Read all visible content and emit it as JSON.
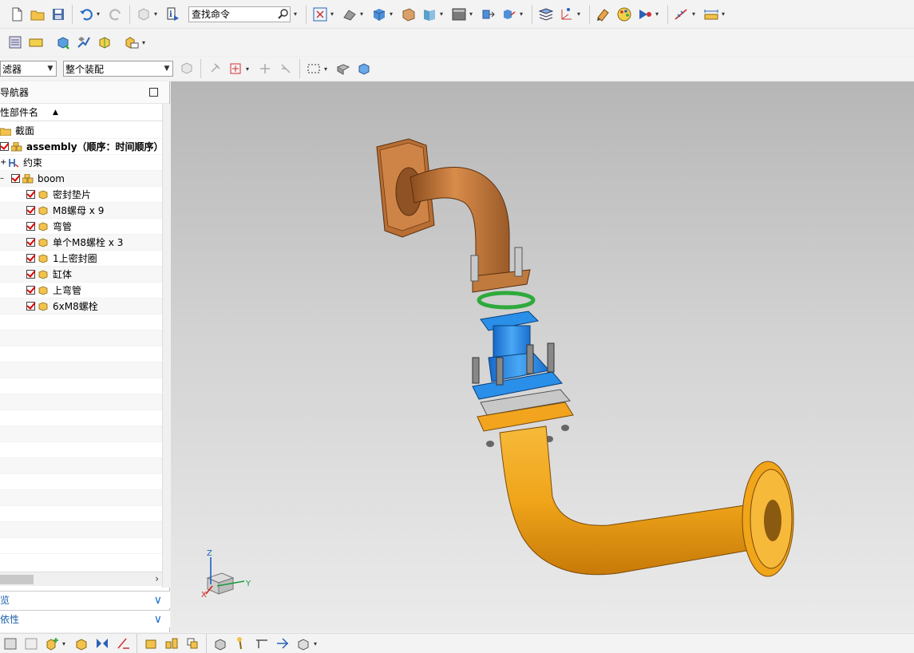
{
  "toolbar": {
    "search_placeholder": "查找命令"
  },
  "filterbar": {
    "selection_filter": "滤器",
    "scope": "整个装配"
  },
  "navigator": {
    "title": "导航器",
    "column_header": "性部件名",
    "rows": [
      {
        "label": "截面"
      },
      {
        "label": "assembly（顺序：时间顺序）"
      },
      {
        "label": "约束"
      },
      {
        "label": "boom"
      },
      {
        "label": "密封垫片"
      },
      {
        "label": "M8螺母 x 9"
      },
      {
        "label": "弯管"
      },
      {
        "label": "单个M8螺栓 x 3"
      },
      {
        "label": "1上密封圈"
      },
      {
        "label": "缸体"
      },
      {
        "label": "上弯管"
      },
      {
        "label": "6xM8螺栓"
      }
    ],
    "sections": [
      {
        "label": "览"
      },
      {
        "label": "依性"
      }
    ]
  },
  "viewport": {
    "triad": {
      "z": "Z",
      "y": "Y",
      "x": "X"
    }
  },
  "colors": {
    "upper_pipe": "#c47a3c",
    "lower_pipe": "#f0a51a",
    "blue_body": "#2a8fe8",
    "green_seal": "#2eaa3c"
  }
}
